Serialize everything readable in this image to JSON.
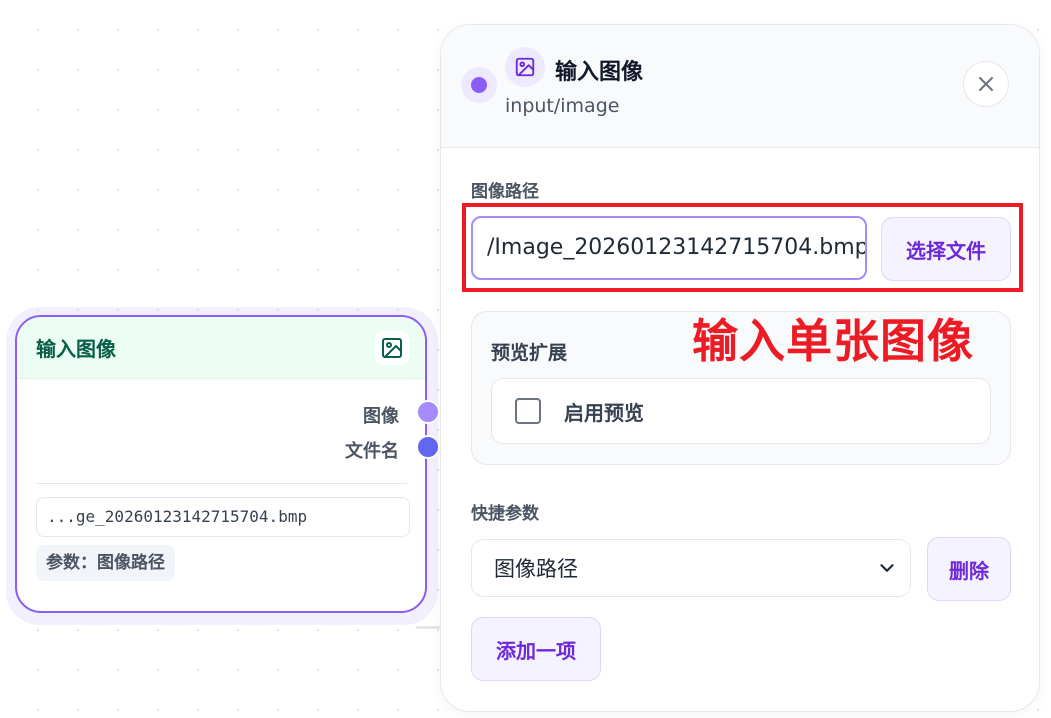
{
  "node": {
    "title": "输入图像",
    "outputs": [
      {
        "label": "图像",
        "color": "#a78bfa"
      },
      {
        "label": "文件名",
        "color": "#6366f1"
      }
    ],
    "path_preview": "...ge_20260123142715704.bmp",
    "param_tag": "参数：图像路径"
  },
  "panel": {
    "title": "输入图像",
    "subtitle": "input/image",
    "close_label": "×",
    "path_section_label": "图像路径",
    "path_value": "/Image_20260123142715704.bmp",
    "choose_file_label": "选择文件",
    "preview_section_label": "预览扩展",
    "enable_preview_label": "启用预览",
    "enable_preview_checked": false,
    "quick_params_label": "快捷参数",
    "quick_param_selected": "图像路径",
    "delete_label": "删除",
    "add_item_label": "添加一项"
  },
  "annotation": {
    "text": "输入单张图像"
  },
  "colors": {
    "accent": "#8b5cf6",
    "annotation_red": "#ed1c24",
    "node_header_bg": "#ecfdf3",
    "node_title": "#065f46"
  }
}
